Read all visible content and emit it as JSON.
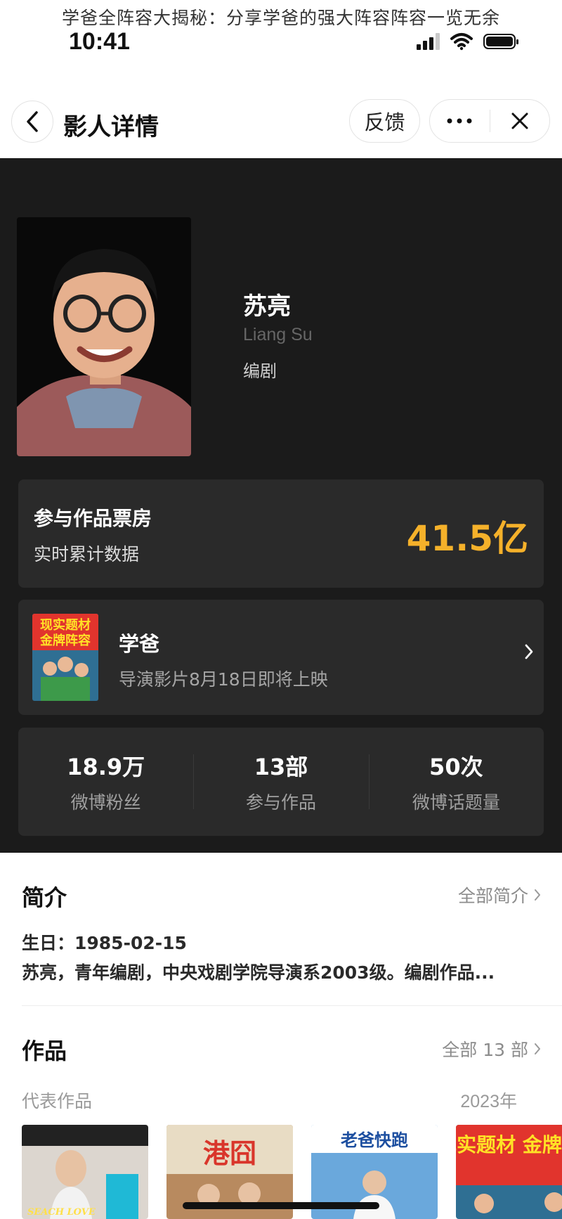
{
  "caption": "学爸全阵容大揭秘：分享学爸的强大阵容阵容一览无余",
  "status_bar": {
    "time": "10:41"
  },
  "nav": {
    "title": "影人详情",
    "feedback": "反馈"
  },
  "person": {
    "name": "苏亮",
    "name_en": "Liang Su",
    "role": "编剧"
  },
  "box_office": {
    "title": "参与作品票房",
    "subtitle": "实时累计数据",
    "value": "41.5亿"
  },
  "featured_film": {
    "title": "学爸",
    "subtitle": "导演影片8月18日即将上映",
    "poster_text": [
      "现实题材",
      "金牌阵容"
    ]
  },
  "stats": [
    {
      "value": "18.9万",
      "label": "微博粉丝"
    },
    {
      "value": "13部",
      "label": "参与作品"
    },
    {
      "value": "50次",
      "label": "微博话题量"
    }
  ],
  "intro": {
    "title": "简介",
    "link": "全部简介",
    "birthday": "生日：1985-02-15",
    "bio": "苏亮，青年编剧，中央戏剧学院导演系2003级。编剧作品..."
  },
  "works": {
    "title": "作品",
    "link": "全部 13 部",
    "rep_label": "代表作品",
    "rep_year": "2023年",
    "posters": [
      {
        "text": "SEACH LOVE",
        "accent": "#1fb9d6"
      },
      {
        "text": "港囧",
        "accent": "#d9352b"
      },
      {
        "text": "老爸快跑",
        "accent": "#ffd21f"
      },
      {
        "text": "现实题材 金牌阵容",
        "accent": "#f0d020"
      }
    ]
  },
  "colors": {
    "accent_gold": "#f5b12a",
    "dark_bg": "#1b1b1b",
    "card_bg": "#2a2a2a"
  }
}
